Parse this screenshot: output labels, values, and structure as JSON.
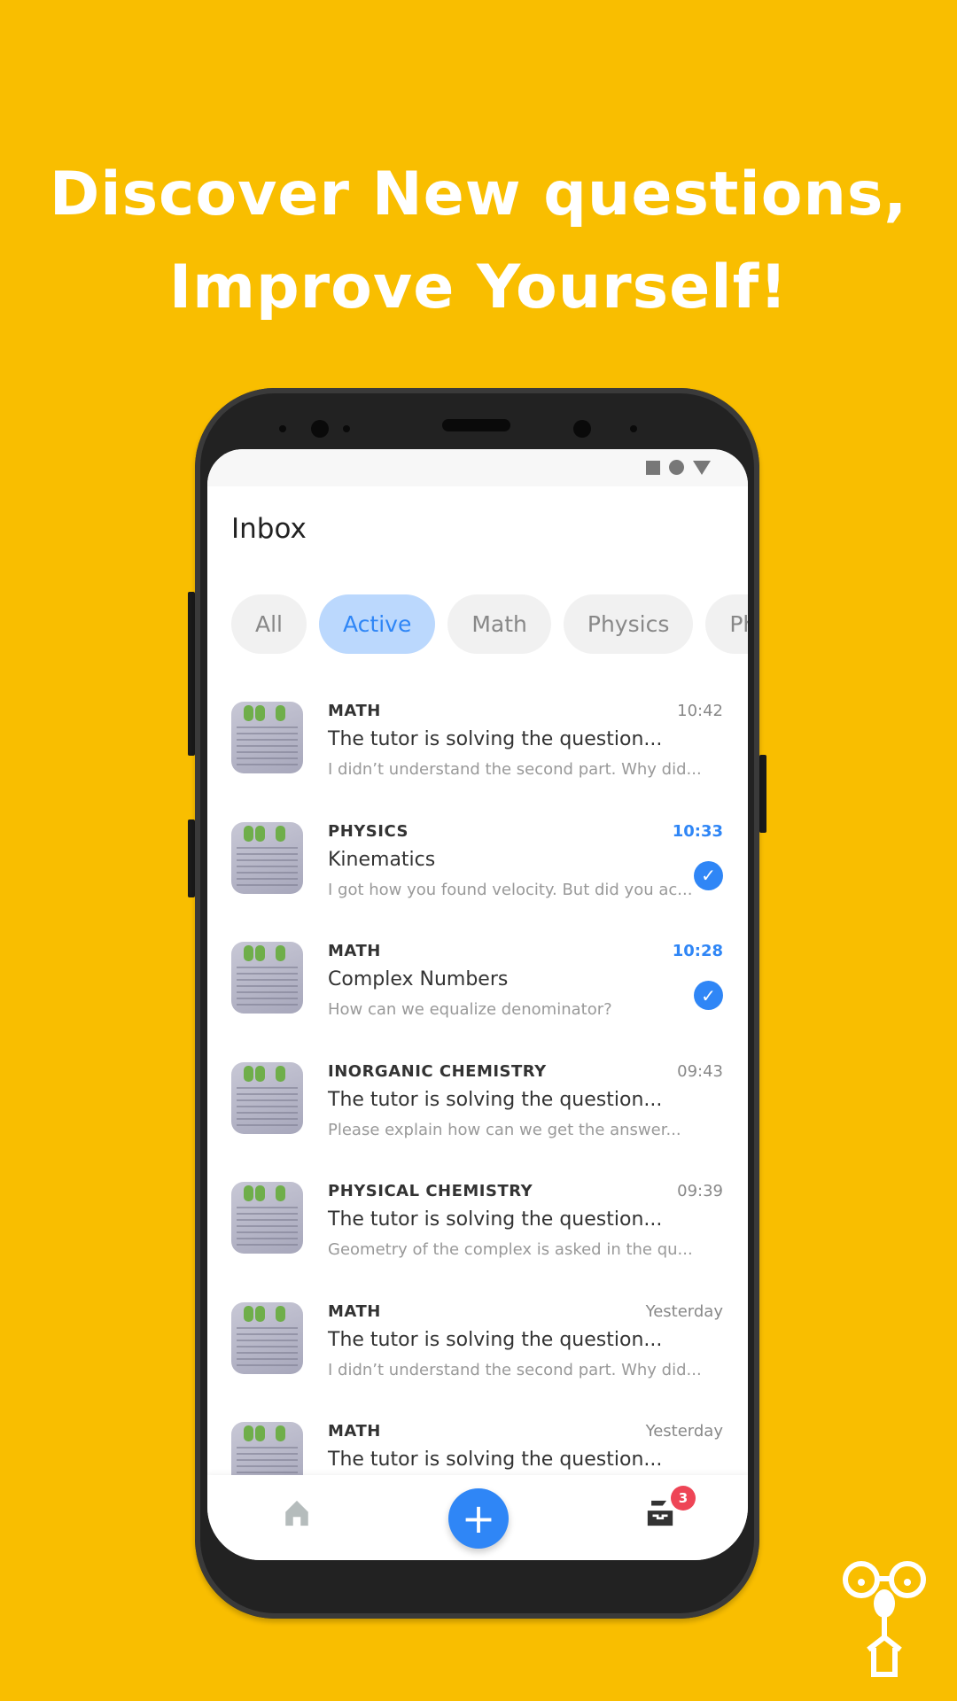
{
  "headline": {
    "line1": "Discover New questions,",
    "line2": "Improve Yourself!"
  },
  "screen": {
    "title": "Inbox",
    "filters": [
      {
        "label": "All",
        "active": false
      },
      {
        "label": "Active",
        "active": true
      },
      {
        "label": "Math",
        "active": false
      },
      {
        "label": "Physics",
        "active": false
      },
      {
        "label": "Ph",
        "active": false
      }
    ],
    "items": [
      {
        "category": "MATH",
        "subject": "The tutor is solving the question...",
        "preview": "I didn’t understand the second part. Why did...",
        "time": "10:42",
        "highlighted": false,
        "checked": false
      },
      {
        "category": "PHYSICS",
        "subject": "Kinematics",
        "preview": "I got how you found velocity. But did you ac...",
        "time": "10:33",
        "highlighted": true,
        "checked": true
      },
      {
        "category": "MATH",
        "subject": "Complex Numbers",
        "preview": "How can we  equalize denominator?",
        "time": "10:28",
        "highlighted": true,
        "checked": true
      },
      {
        "category": "INORGANIC CHEMISTRY",
        "subject": "The tutor is solving the question...",
        "preview": "Please explain how can we get the answer...",
        "time": "09:43",
        "highlighted": false,
        "checked": false
      },
      {
        "category": "PHYSICAL CHEMISTRY",
        "subject": "The tutor is solving the question...",
        "preview": "Geometry of the complex is asked in the qu...",
        "time": "09:39",
        "highlighted": false,
        "checked": false
      },
      {
        "category": "MATH",
        "subject": "The tutor is solving the question...",
        "preview": "I didn’t understand the second part. Why did...",
        "time": "Yesterday",
        "highlighted": false,
        "checked": false
      },
      {
        "category": "MATH",
        "subject": "The tutor is solving the question...",
        "preview": "",
        "time": "Yesterday",
        "highlighted": false,
        "checked": false
      }
    ],
    "nav": {
      "home_icon": "home-icon",
      "add_icon": "plus-icon",
      "add_label": "+",
      "inbox_icon": "inbox-tray-icon",
      "inbox_badge": "3"
    },
    "colors": {
      "accent": "#2F86F6",
      "background": "#F9BE00",
      "badge": "#EE4556"
    }
  }
}
